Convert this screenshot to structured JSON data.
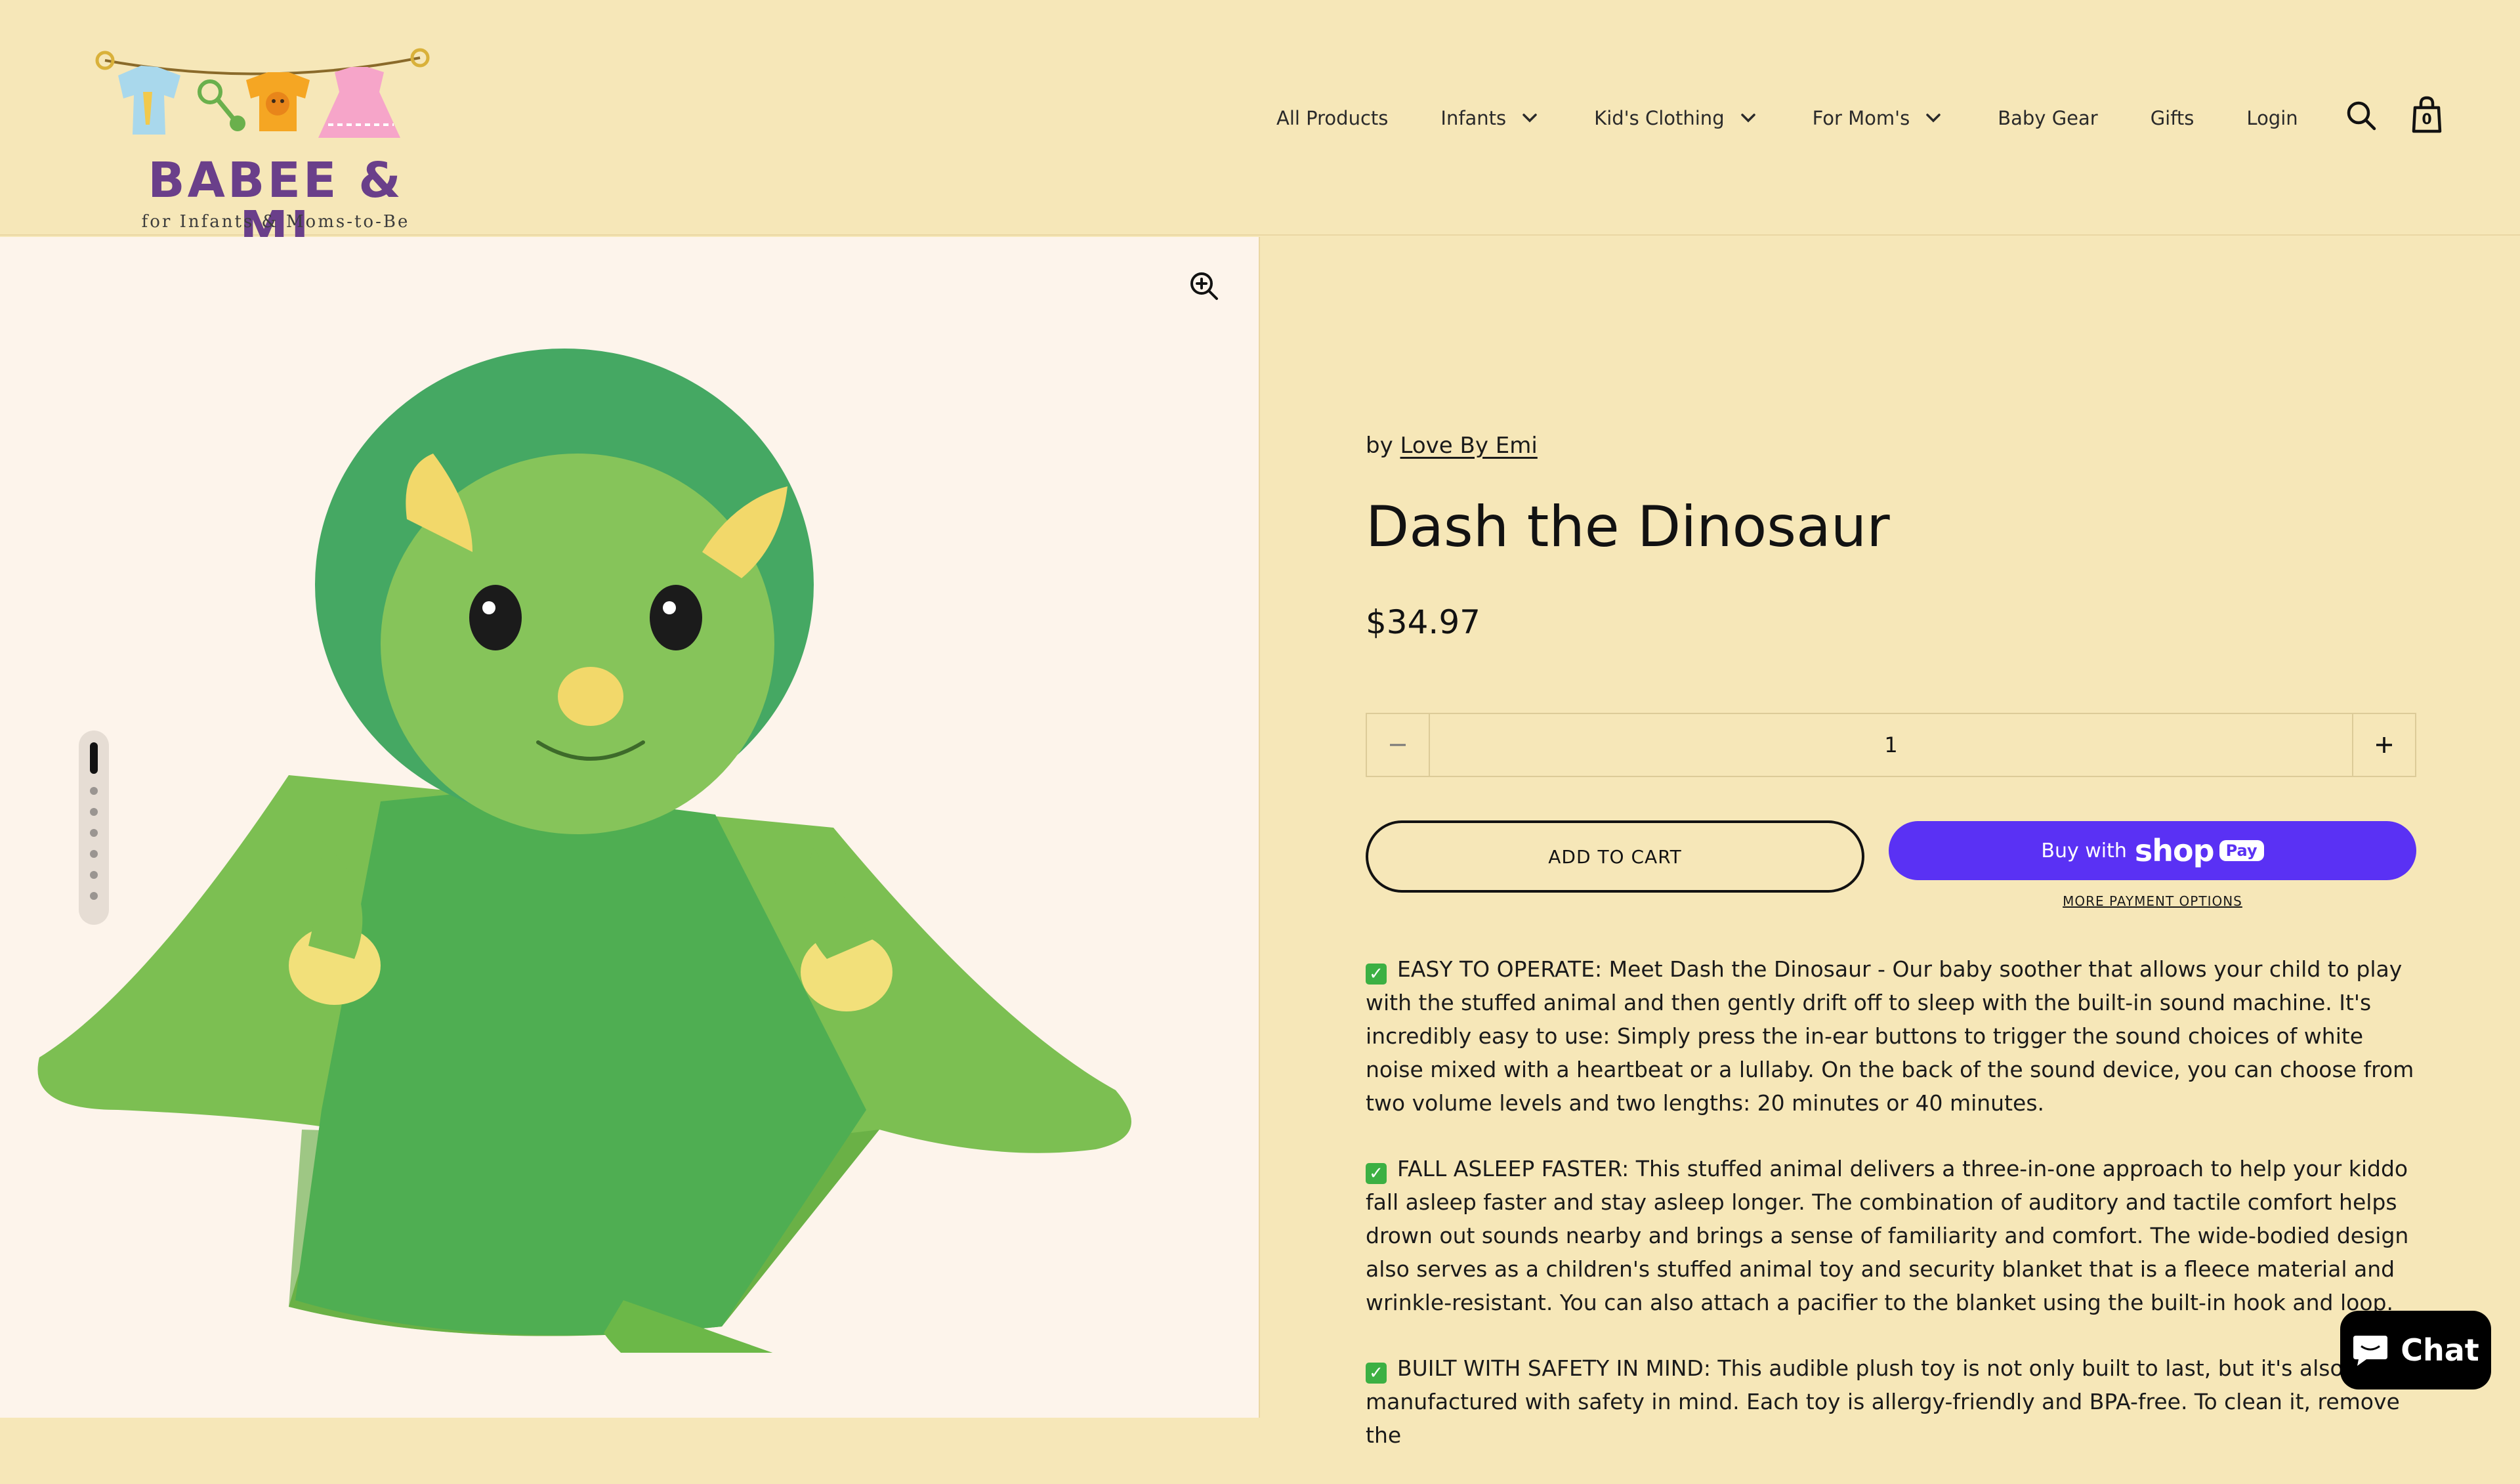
{
  "brand": {
    "name": "BABEE & MI",
    "tagline": "for Infants & Moms-to-Be"
  },
  "nav": {
    "items": [
      {
        "label": "All Products",
        "has_dropdown": false
      },
      {
        "label": "Infants",
        "has_dropdown": true
      },
      {
        "label": "Kid's Clothing",
        "has_dropdown": true
      },
      {
        "label": "For Mom's",
        "has_dropdown": true
      },
      {
        "label": "Baby Gear",
        "has_dropdown": false
      },
      {
        "label": "Gifts",
        "has_dropdown": false
      },
      {
        "label": "Login",
        "has_dropdown": false
      }
    ],
    "search_icon": "search-icon",
    "cart_icon": "shopping-bag-icon",
    "cart_count": "0"
  },
  "gallery": {
    "zoom_icon": "zoom-in-icon",
    "image_alt": "Green plush dinosaur lovey blanket",
    "slide_count": 7,
    "active_slide": 1
  },
  "product": {
    "vendor_prefix": "by",
    "vendor": "Love By Emi",
    "title": "Dash the Dinosaur",
    "price": "$34.97",
    "quantity": "1",
    "add_to_cart": "ADD TO CART",
    "buy_with": "Buy with",
    "shop_word": "shop",
    "pay_word": "Pay",
    "more_payment": "MORE PAYMENT OPTIONS",
    "description": [
      "EASY TO OPERATE: Meet Dash the Dinosaur - Our baby soother that allows your child to play with the stuffed animal and then gently drift off to sleep with the built-in sound machine. It's incredibly easy to use: Simply press the in-ear buttons to trigger the sound choices of white noise mixed with a heartbeat or a lullaby. On the back of the sound device, you can choose from two volume levels and two lengths: 20 minutes or 40 minutes.",
      "FALL ASLEEP FASTER: This stuffed animal delivers a three-in-one approach to help your kiddo fall asleep faster and stay asleep longer. The combination of auditory and tactile comfort helps drown out sounds nearby and brings a sense of familiarity and comfort. The wide-bodied design also serves as a children's stuffed animal toy and security blanket that is a fleece material and wrinkle-resistant. You can also attach a pacifier to the blanket using the built-in hook and loop.",
      "BUILT WITH SAFETY IN MIND: This audible plush toy is not only built to last, but it's also manufactured with safety in mind. Each toy is allergy-friendly and BPA-free. To clean it, remove the"
    ],
    "check_icon": "check-mark-icon"
  },
  "chat": {
    "label": "Chat",
    "icon": "chat-bubble-icon"
  },
  "colors": {
    "header_bg": "#f6e7b8",
    "gallery_bg": "#fdf4eb",
    "shop_pay": "#5a31f4",
    "text": "#121212",
    "check_green": "#3cb043"
  }
}
